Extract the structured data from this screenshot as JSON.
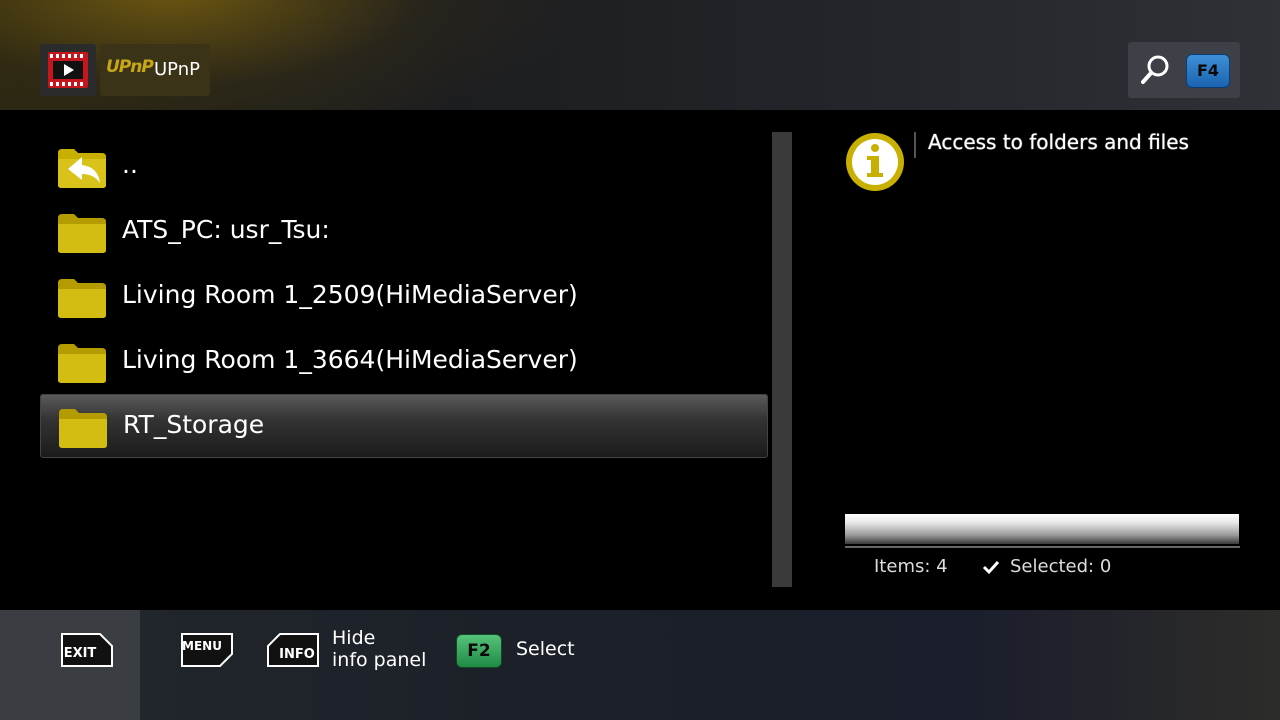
{
  "header": {
    "breadcrumb_logo": "UPnP",
    "breadcrumb_label": "UPnP",
    "search_key": "F4"
  },
  "file_list": {
    "items": [
      {
        "label": "..",
        "type": "parent"
      },
      {
        "label": "ATS_PC: usr_Tsu:",
        "type": "folder"
      },
      {
        "label": "Living Room 1_2509(HiMediaServer)",
        "type": "folder"
      },
      {
        "label": "Living Room 1_3664(HiMediaServer)",
        "type": "folder"
      },
      {
        "label": "RT_Storage",
        "type": "folder",
        "selected": true
      }
    ]
  },
  "info_panel": {
    "text": "Access to folders and files",
    "items_label": "Items: 4",
    "selected_label": "Selected: 0"
  },
  "footer": {
    "exit_key": "EXIT",
    "menu_key": "MENU",
    "info_key": "INFO",
    "info_label_line1": "Hide",
    "info_label_line2": "info panel",
    "select_key": "F2",
    "select_label": "Select"
  },
  "colors": {
    "folder_yellow": "#c8b000",
    "accent_blue": "#2a7ac8",
    "accent_green": "#3aa35f"
  }
}
